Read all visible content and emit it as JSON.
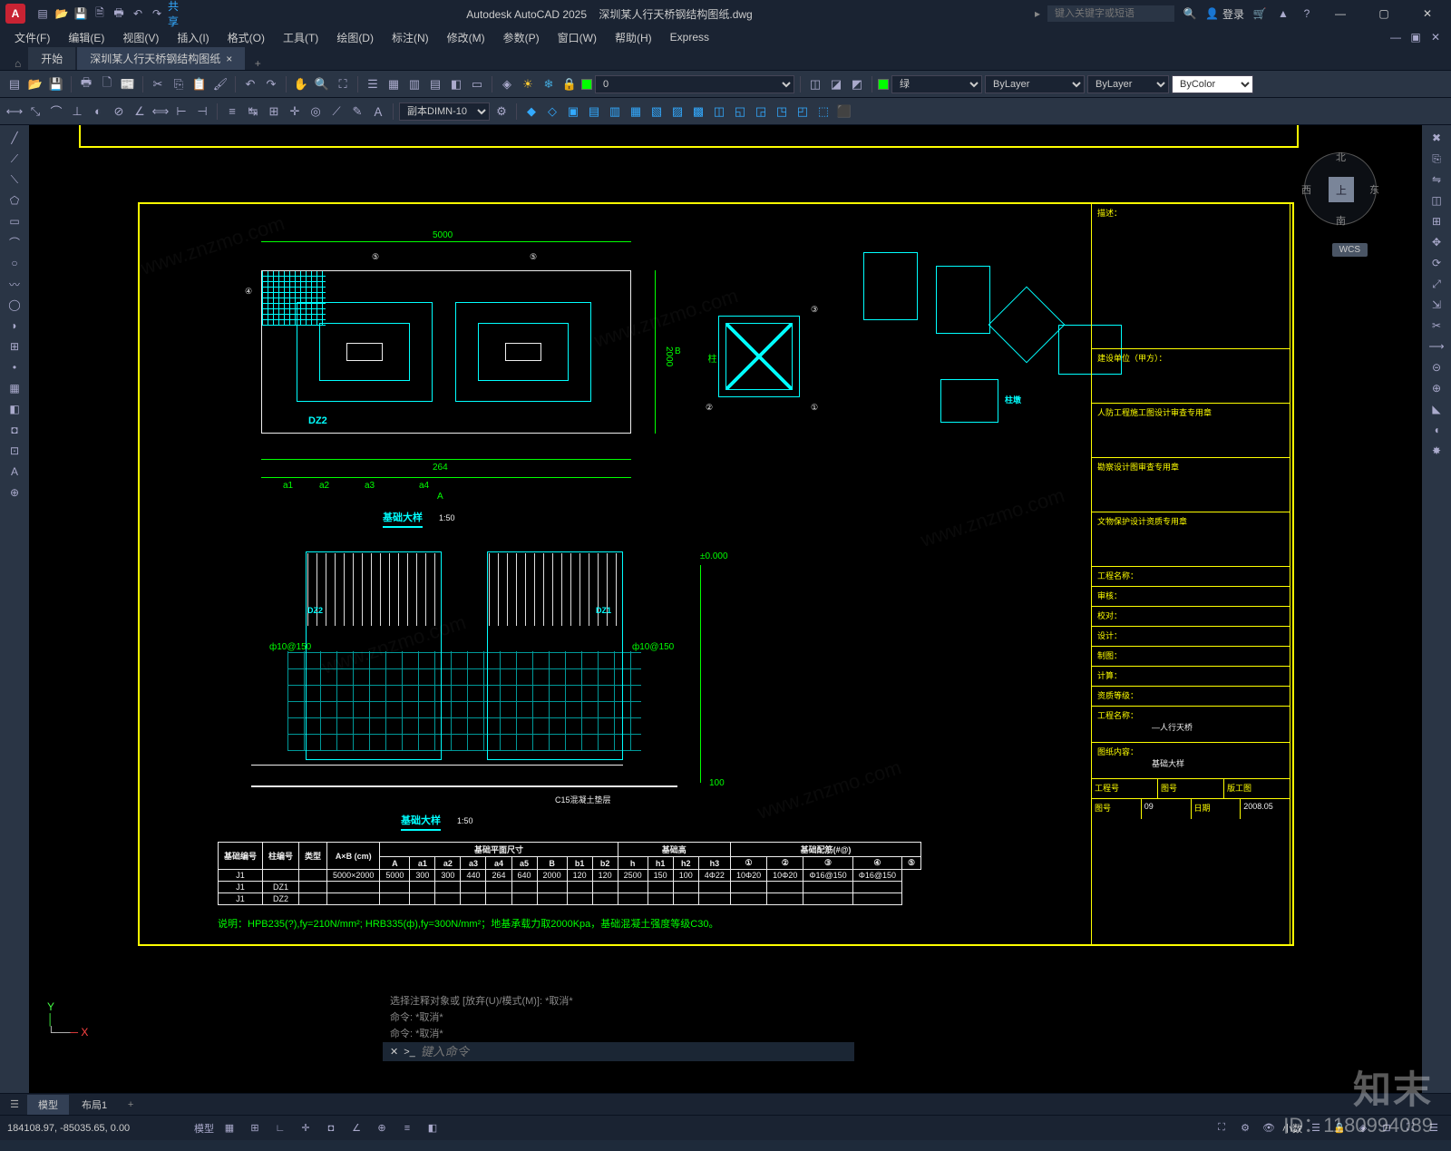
{
  "app": {
    "icon": "A",
    "title": "Autodesk AutoCAD 2025",
    "doc": "深圳某人行天桥钢结构图纸.dwg",
    "share": "共享",
    "search_ph": "键入关键字或短语",
    "login": "登录"
  },
  "menu": [
    "文件(F)",
    "编辑(E)",
    "视图(V)",
    "插入(I)",
    "格式(O)",
    "工具(T)",
    "绘图(D)",
    "标注(N)",
    "修改(M)",
    "参数(P)",
    "窗口(W)",
    "帮助(H)",
    "Express"
  ],
  "tabs": {
    "start": "开始",
    "active": "深圳某人行天桥钢结构图纸"
  },
  "tool": {
    "dimstyle": "副本DIMN-10",
    "zero": "0",
    "layer_color": "绿",
    "linetype": "ByLayer",
    "lineweight": "ByLayer",
    "bycolor": "ByColor"
  },
  "viewcube": {
    "n": "北",
    "s": "南",
    "e": "东",
    "w": "西",
    "top": "上"
  },
  "wcs": "WCS",
  "model_tabs": {
    "model": "模型",
    "layout": "布局1"
  },
  "status": {
    "coords": "184108.97, -85035.65, 0.00",
    "model": "模型",
    "dec": "小数"
  },
  "cmd": {
    "hist1": "选择注释对象或 [放弃(U)/模式(M)]: *取消*",
    "hist2": "命令: *取消*",
    "hist3": "命令: *取消*",
    "prompt": "键入命令",
    "chev": ">_"
  },
  "drawing": {
    "dim_5000": "5000",
    "dim_264": "264",
    "dim_2000": "2000",
    "dim_100": "100",
    "elev0": "±0.000",
    "title_plan": "基础大样",
    "title_sec": "基础大样",
    "scale": "1:50",
    "c15": "C15混凝土垫层",
    "dz1": "DZ1",
    "dz2": "DZ2",
    "axis_A": "A",
    "axis_B": "B",
    "a1": "a1",
    "a2": "a2",
    "a3": "a3",
    "a4": "a4",
    "note": "说明：HPB235(?),fy=210N/mm²; HRB335(ф),fy=300N/mm²；地基承载力取2000Kpa，基础混凝土强度等级C30。",
    "g10_150": "ф10@150",
    "marks": [
      "①",
      "②",
      "③",
      "④",
      "⑤"
    ],
    "col_label": "柱墩"
  },
  "table": {
    "h0": "基础编号",
    "h1": "柱编号",
    "h2": "类型",
    "h3": "A×B (cm)",
    "grp1": "基础平面尺寸",
    "grp2": "基础高",
    "grp3": "基础配筋(#@)",
    "sub": [
      "A",
      "a1",
      "a2",
      "a3",
      "a4",
      "a5",
      "B",
      "b1",
      "b2",
      "h",
      "h1",
      "h2",
      "h3",
      "①",
      "②",
      "③",
      "④",
      "⑤"
    ],
    "rows": [
      [
        "J1",
        "",
        "",
        "5000×2000",
        "5000",
        "300",
        "300",
        "440",
        "264",
        "640",
        "2000",
        "120",
        "120",
        "2500",
        "150",
        "100",
        "4Φ22",
        "10Φ20",
        "10Φ20",
        "Φ16@150",
        "Φ16@150"
      ],
      [
        "J1",
        "DZ1",
        "",
        "",
        "",
        "",
        "",
        "",
        "",
        "",
        "",
        "",
        "",
        "",
        "",
        "",
        "",
        "",
        "",
        "",
        ""
      ],
      [
        "J1",
        "DZ2",
        "",
        "",
        "",
        "",
        "",
        "",
        "",
        "",
        "",
        "",
        "",
        "",
        "",
        "",
        "",
        "",
        "",
        "",
        ""
      ]
    ]
  },
  "titleblock": {
    "t1": "描述：",
    "t2": "建设单位（甲方）：",
    "t3": "人防工程施工图设计审查专用章",
    "t4": "勘察设计图审查专用章",
    "t5": "文物保护设计资质专用章",
    "t6": "工程名称：",
    "t7": "审核：",
    "t8": "校对：",
    "t9": "设计：",
    "t10": "制图：",
    "t11": "计算：",
    "t12": "资质等级：",
    "t13": "工程名称：",
    "t13v": "—人行天桥",
    "t14": "图纸内容：",
    "t14v": "基础大样",
    "t15a": "工程号",
    "t15b": "图号",
    "t15c": "版工图",
    "t16a": "图号",
    "t16b": "09",
    "t16c": "日期",
    "t16d": "2008.05"
  },
  "wm": {
    "brand": "知末",
    "id": "ID：1180994089",
    "url": "www.znzmo.com"
  }
}
